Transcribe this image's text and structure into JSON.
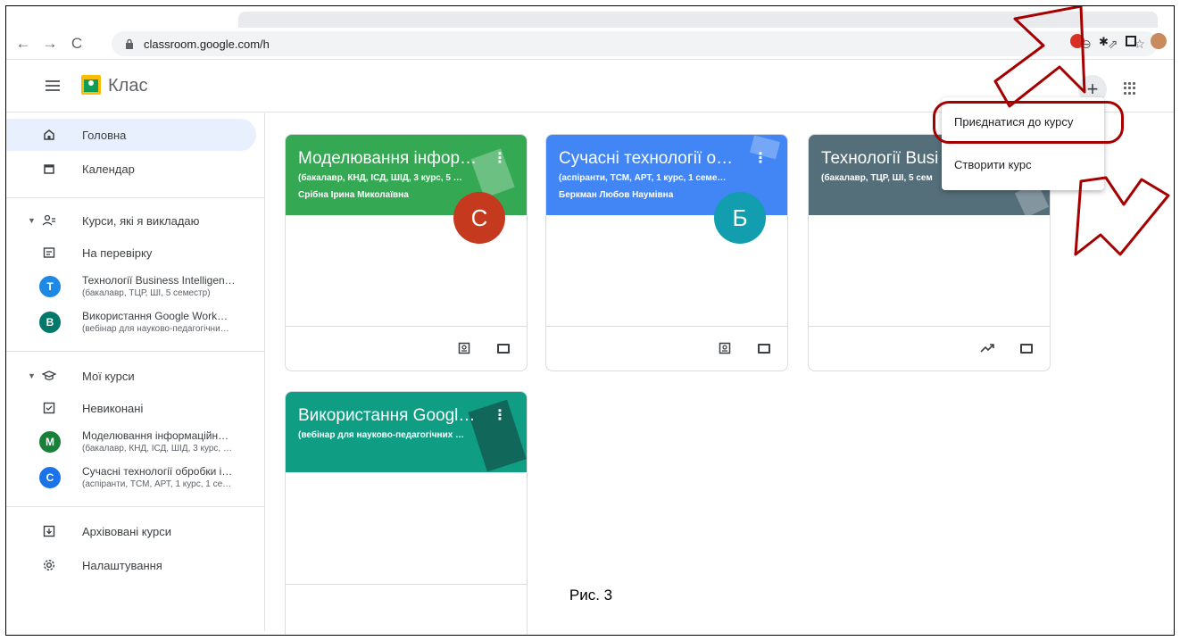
{
  "browser": {
    "url": "classroom.google.com/h"
  },
  "app": {
    "title": "Клас"
  },
  "sidebar": {
    "items": [
      {
        "label": "Головна",
        "icon": "home-icon"
      },
      {
        "label": "Календар",
        "icon": "calendar-icon"
      }
    ],
    "teaching": {
      "label": "Курси, які я викладаю",
      "review": "На перевірку",
      "courses": [
        {
          "initial": "T",
          "name": "Технології Business Intelligen…",
          "sub": "(бакалавр, ТЦР, ШІ, 5 семестр)",
          "color": "#1e88e5"
        },
        {
          "initial": "В",
          "name": "Використання Google Work…",
          "sub": "(вебінар для науково-педагогічни…",
          "color": "#00796b"
        }
      ]
    },
    "enrolled": {
      "label": "Мої курси",
      "todo": "Невиконані",
      "courses": [
        {
          "initial": "M",
          "name": "Моделювання інформаційн…",
          "sub": "(бакалавр, КНД, ІСД, ШІД, 3 курс, …",
          "color": "#188038"
        },
        {
          "initial": "С",
          "name": "Сучасні технології обробки і…",
          "sub": "(аспіранти, ТСМ, АРТ, 1 курс, 1 се…",
          "color": "#1a73e8"
        }
      ]
    },
    "archived": "Архівовані курси",
    "settings": "Налаштування"
  },
  "cards": [
    {
      "title": "Моделювання інфор…",
      "section": "(бакалавр, КНД, ІСД, ШІД, 3 курс, 5 …",
      "teacher": "Срібна Ірина Миколаївна",
      "initial": "С",
      "header_color": "#34a853",
      "badge_color": "#c5391f"
    },
    {
      "title": "Сучасні технології о…",
      "section": "(аспіранти, ТСМ, АРТ, 1 курс, 1 семе…",
      "teacher": "Беркман Любов Наумівна",
      "initial": "Б",
      "header_color": "#4285f4",
      "badge_color": "#129eaf"
    },
    {
      "title": "Технології Busi",
      "section": "(бакалавр, ТЦР, ШІ, 5 сем",
      "teacher": "",
      "initial": "",
      "header_color": "#546e7a",
      "badge_color": ""
    },
    {
      "title": "Використання Googl…",
      "section": "(вебінар для науково-педагогічних …",
      "teacher": "",
      "initial": "",
      "header_color": "#0f9d84",
      "badge_color": ""
    }
  ],
  "menu": {
    "join": "Приєднатися до курсу",
    "create": "Створити курс"
  },
  "caption": "Рис. 3",
  "colors": {
    "annotation": "#a50000",
    "active_nav": "#e8f0fe"
  }
}
